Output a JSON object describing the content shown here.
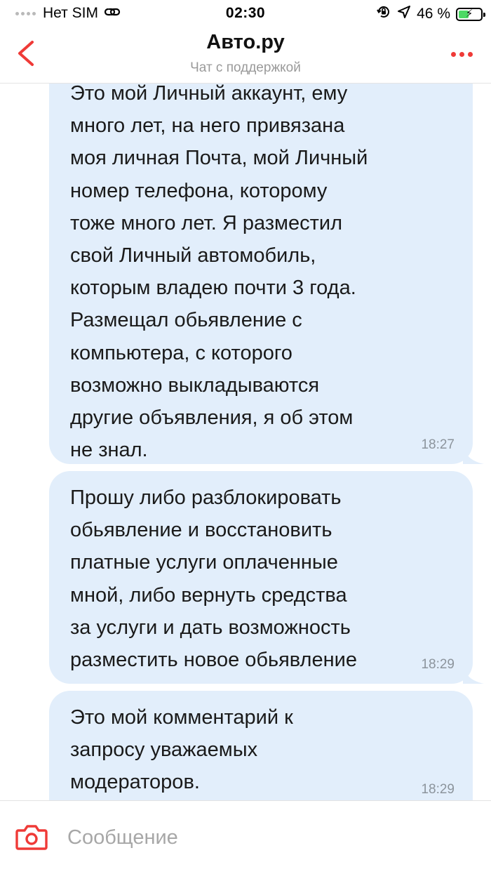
{
  "status_bar": {
    "carrier": "Нет SIM",
    "time": "02:30",
    "battery_percent": "46 %",
    "battery_level": 0.46,
    "icons": [
      "wifi-icon",
      "orientation-lock-icon",
      "location-arrow-icon",
      "battery-charging-icon"
    ]
  },
  "header": {
    "title": "Авто.ру",
    "subtitle": "Чат с поддержкой",
    "back_icon": "chevron-left-icon",
    "more_icon": "more-dots-icon"
  },
  "messages": [
    {
      "text": "Это мой Личный аккаунт, ему\nмного лет, на него привязана\nмоя личная Почта, мой Личный\nномер телефона, которому\nтоже много лет. Я разместил\nсвой Личный автомобиль,\nкоторым владею почти 3 года.\nРазмещал обьявление с\nкомпьютера, с которого\nвозможно выкладываются\nдругие объявления, я об этом\nне знал.",
      "time": "18:27"
    },
    {
      "text": "Прошу либо разблокировать\nобьявление и восстановить\nплатные услуги оплаченные\nмной, либо вернуть средства\nза услуги и дать возможность\nразместить новое обьявление",
      "time": "18:29"
    },
    {
      "text": "Это мой комментарий к\nзапросу уважаемых\nмодераторов.",
      "time": "18:29"
    }
  ],
  "input": {
    "placeholder": "Сообщение",
    "value": "",
    "camera_icon": "camera-icon"
  },
  "colors": {
    "accent": "#ef3a37",
    "bubble": "#e2eefb",
    "battery": "#4cd964"
  }
}
